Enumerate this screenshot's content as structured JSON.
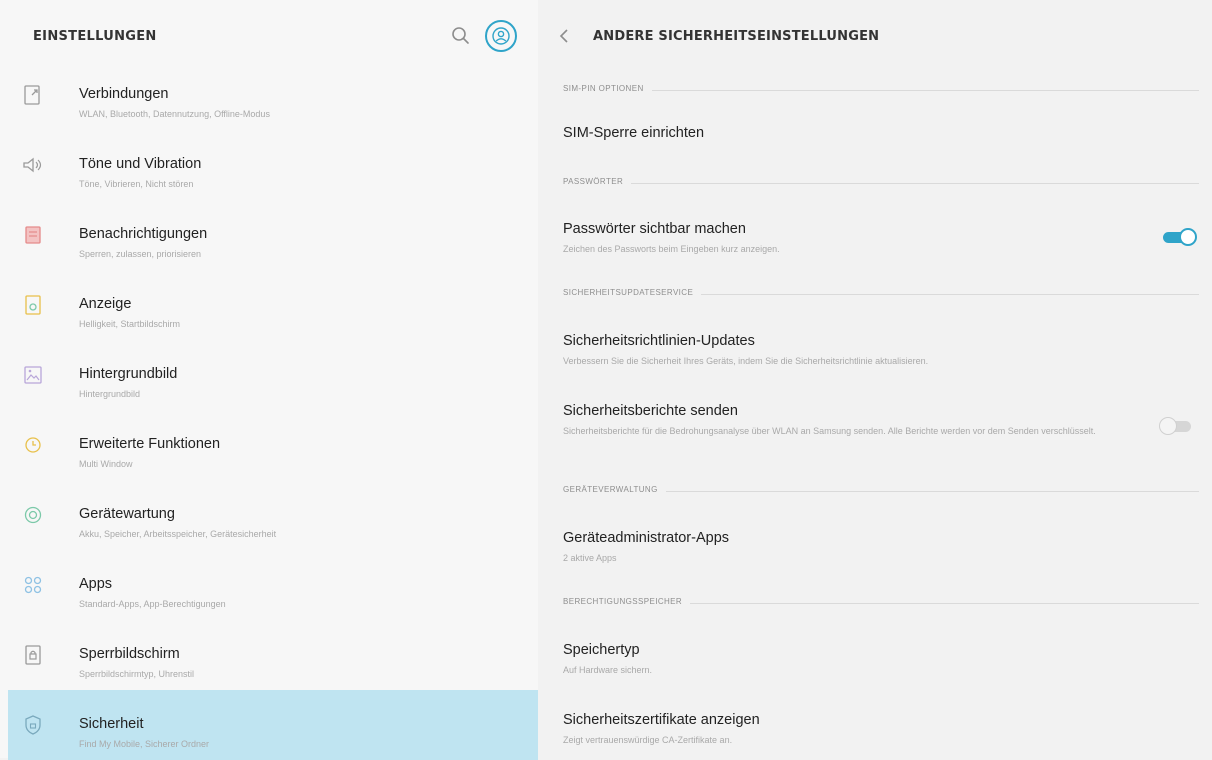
{
  "left": {
    "title": "EINSTELLUNGEN",
    "search_icon": "search-icon",
    "account_icon": "account-icon",
    "items": [
      {
        "label": "Verbindungen",
        "sub": "WLAN, Bluetooth, Datennutzung, Offline-Modus",
        "icon": "connections-icon"
      },
      {
        "label": "Töne und Vibration",
        "sub": "Töne, Vibrieren, Nicht stören",
        "icon": "sound-icon"
      },
      {
        "label": "Benachrichtigungen",
        "sub": "Sperren, zulassen, priorisieren",
        "icon": "notifications-icon"
      },
      {
        "label": "Anzeige",
        "sub": "Helligkeit, Startbildschirm",
        "icon": "display-icon"
      },
      {
        "label": "Hintergrundbild",
        "sub": "Hintergrundbild",
        "icon": "wallpaper-icon"
      },
      {
        "label": "Erweiterte Funktionen",
        "sub": "Multi Window",
        "icon": "advanced-features-icon"
      },
      {
        "label": "Gerätewartung",
        "sub": "Akku, Speicher, Arbeitsspeicher, Gerätesicherheit",
        "icon": "device-maintenance-icon"
      },
      {
        "label": "Apps",
        "sub": "Standard-Apps, App-Berechtigungen",
        "icon": "apps-icon"
      },
      {
        "label": "Sperrbildschirm",
        "sub": "Sperrbildschirmtyp, Uhrenstil",
        "icon": "lock-screen-icon"
      },
      {
        "label": "Sicherheit",
        "sub": "Find My Mobile, Sicherer Ordner",
        "icon": "security-icon",
        "selected": true
      }
    ]
  },
  "right": {
    "title": "ANDERE SICHERHEITSEINSTELLUNGEN",
    "back_icon": "back-chevron-icon",
    "sections": {
      "sim": "SIM-PIN OPTIONEN",
      "passwords": "PASSWÖRTER",
      "security_update": "SICHERHEITSUPDATESERVICE",
      "device_admin": "GERÄTEVERWALTUNG",
      "credential_storage": "BERECHTIGUNGSSPEICHER"
    },
    "rows": {
      "sim_lock": {
        "title": "SIM-Sperre einrichten"
      },
      "show_passwords": {
        "title": "Passwörter sichtbar machen",
        "sub": "Zeichen des Passworts beim Eingeben kurz anzeigen.",
        "toggle": "on"
      },
      "policy_updates": {
        "title": "Sicherheitsrichtlinien-Updates",
        "sub": "Verbessern Sie die Sicherheit Ihres Geräts, indem Sie die Sicherheitsrichtlinie aktualisieren."
      },
      "send_reports": {
        "title": "Sicherheitsberichte senden",
        "sub": "Sicherheitsberichte für die Bedrohungsanalyse über WLAN an Samsung senden. Alle Berichte werden vor dem Senden verschlüsselt.",
        "toggle": "off"
      },
      "device_admin_apps": {
        "title": "Geräteadministrator-Apps",
        "sub": "2 aktive Apps"
      },
      "storage_type": {
        "title": "Speichertyp",
        "sub": "Auf Hardware sichern."
      },
      "view_certs": {
        "title": "Sicherheitszertifikate anzeigen",
        "sub": "Zeigt vertrauenswürdige CA-Zertifikate an."
      }
    }
  },
  "colors": {
    "accent": "#2fa4c9",
    "selected_bg": "#bfe4f1",
    "icon_gray": "#9a9a9a",
    "icon_red": "#e58b8b",
    "icon_yellow": "#e8c04a",
    "icon_green": "#7cc9a9",
    "icon_blue": "#8fc2e4",
    "icon_purple": "#b8a6d9"
  }
}
